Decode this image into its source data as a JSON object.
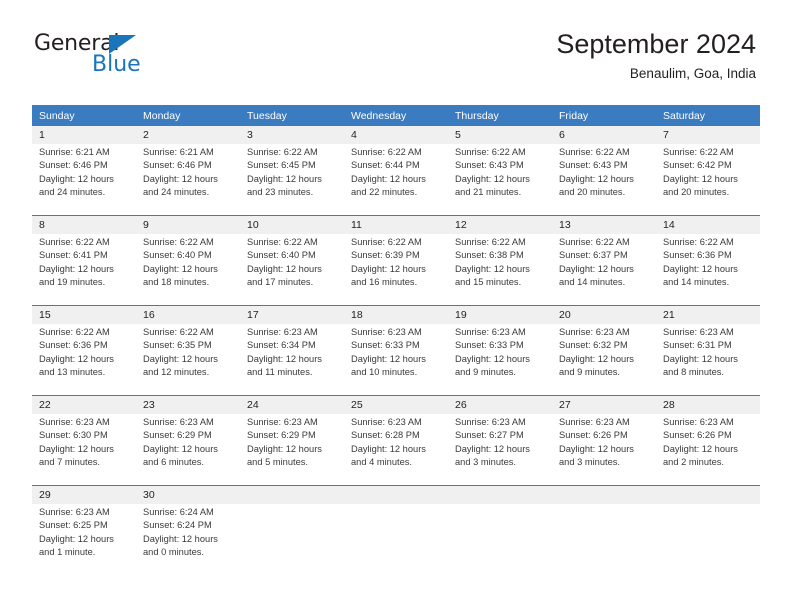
{
  "brand": {
    "name_part1": "General",
    "name_part2": "Blue",
    "accent_color": "#1b75bb"
  },
  "header": {
    "title": "September 2024",
    "subtitle": "Benaulim, Goa, India"
  },
  "theme": {
    "header_row_bg": "#3b7bbf",
    "day_number_bg": "#f0f0f0",
    "text_color": "#231f20"
  },
  "weekdays": [
    "Sunday",
    "Monday",
    "Tuesday",
    "Wednesday",
    "Thursday",
    "Friday",
    "Saturday"
  ],
  "weeks": [
    [
      {
        "day": "1",
        "lines": [
          "Sunrise: 6:21 AM",
          "Sunset: 6:46 PM",
          "Daylight: 12 hours",
          "and 24 minutes."
        ]
      },
      {
        "day": "2",
        "lines": [
          "Sunrise: 6:21 AM",
          "Sunset: 6:46 PM",
          "Daylight: 12 hours",
          "and 24 minutes."
        ]
      },
      {
        "day": "3",
        "lines": [
          "Sunrise: 6:22 AM",
          "Sunset: 6:45 PM",
          "Daylight: 12 hours",
          "and 23 minutes."
        ]
      },
      {
        "day": "4",
        "lines": [
          "Sunrise: 6:22 AM",
          "Sunset: 6:44 PM",
          "Daylight: 12 hours",
          "and 22 minutes."
        ]
      },
      {
        "day": "5",
        "lines": [
          "Sunrise: 6:22 AM",
          "Sunset: 6:43 PM",
          "Daylight: 12 hours",
          "and 21 minutes."
        ]
      },
      {
        "day": "6",
        "lines": [
          "Sunrise: 6:22 AM",
          "Sunset: 6:43 PM",
          "Daylight: 12 hours",
          "and 20 minutes."
        ]
      },
      {
        "day": "7",
        "lines": [
          "Sunrise: 6:22 AM",
          "Sunset: 6:42 PM",
          "Daylight: 12 hours",
          "and 20 minutes."
        ]
      }
    ],
    [
      {
        "day": "8",
        "lines": [
          "Sunrise: 6:22 AM",
          "Sunset: 6:41 PM",
          "Daylight: 12 hours",
          "and 19 minutes."
        ]
      },
      {
        "day": "9",
        "lines": [
          "Sunrise: 6:22 AM",
          "Sunset: 6:40 PM",
          "Daylight: 12 hours",
          "and 18 minutes."
        ]
      },
      {
        "day": "10",
        "lines": [
          "Sunrise: 6:22 AM",
          "Sunset: 6:40 PM",
          "Daylight: 12 hours",
          "and 17 minutes."
        ]
      },
      {
        "day": "11",
        "lines": [
          "Sunrise: 6:22 AM",
          "Sunset: 6:39 PM",
          "Daylight: 12 hours",
          "and 16 minutes."
        ]
      },
      {
        "day": "12",
        "lines": [
          "Sunrise: 6:22 AM",
          "Sunset: 6:38 PM",
          "Daylight: 12 hours",
          "and 15 minutes."
        ]
      },
      {
        "day": "13",
        "lines": [
          "Sunrise: 6:22 AM",
          "Sunset: 6:37 PM",
          "Daylight: 12 hours",
          "and 14 minutes."
        ]
      },
      {
        "day": "14",
        "lines": [
          "Sunrise: 6:22 AM",
          "Sunset: 6:36 PM",
          "Daylight: 12 hours",
          "and 14 minutes."
        ]
      }
    ],
    [
      {
        "day": "15",
        "lines": [
          "Sunrise: 6:22 AM",
          "Sunset: 6:36 PM",
          "Daylight: 12 hours",
          "and 13 minutes."
        ]
      },
      {
        "day": "16",
        "lines": [
          "Sunrise: 6:22 AM",
          "Sunset: 6:35 PM",
          "Daylight: 12 hours",
          "and 12 minutes."
        ]
      },
      {
        "day": "17",
        "lines": [
          "Sunrise: 6:23 AM",
          "Sunset: 6:34 PM",
          "Daylight: 12 hours",
          "and 11 minutes."
        ]
      },
      {
        "day": "18",
        "lines": [
          "Sunrise: 6:23 AM",
          "Sunset: 6:33 PM",
          "Daylight: 12 hours",
          "and 10 minutes."
        ]
      },
      {
        "day": "19",
        "lines": [
          "Sunrise: 6:23 AM",
          "Sunset: 6:33 PM",
          "Daylight: 12 hours",
          "and 9 minutes."
        ]
      },
      {
        "day": "20",
        "lines": [
          "Sunrise: 6:23 AM",
          "Sunset: 6:32 PM",
          "Daylight: 12 hours",
          "and 9 minutes."
        ]
      },
      {
        "day": "21",
        "lines": [
          "Sunrise: 6:23 AM",
          "Sunset: 6:31 PM",
          "Daylight: 12 hours",
          "and 8 minutes."
        ]
      }
    ],
    [
      {
        "day": "22",
        "lines": [
          "Sunrise: 6:23 AM",
          "Sunset: 6:30 PM",
          "Daylight: 12 hours",
          "and 7 minutes."
        ]
      },
      {
        "day": "23",
        "lines": [
          "Sunrise: 6:23 AM",
          "Sunset: 6:29 PM",
          "Daylight: 12 hours",
          "and 6 minutes."
        ]
      },
      {
        "day": "24",
        "lines": [
          "Sunrise: 6:23 AM",
          "Sunset: 6:29 PM",
          "Daylight: 12 hours",
          "and 5 minutes."
        ]
      },
      {
        "day": "25",
        "lines": [
          "Sunrise: 6:23 AM",
          "Sunset: 6:28 PM",
          "Daylight: 12 hours",
          "and 4 minutes."
        ]
      },
      {
        "day": "26",
        "lines": [
          "Sunrise: 6:23 AM",
          "Sunset: 6:27 PM",
          "Daylight: 12 hours",
          "and 3 minutes."
        ]
      },
      {
        "day": "27",
        "lines": [
          "Sunrise: 6:23 AM",
          "Sunset: 6:26 PM",
          "Daylight: 12 hours",
          "and 3 minutes."
        ]
      },
      {
        "day": "28",
        "lines": [
          "Sunrise: 6:23 AM",
          "Sunset: 6:26 PM",
          "Daylight: 12 hours",
          "and 2 minutes."
        ]
      }
    ],
    [
      {
        "day": "29",
        "lines": [
          "Sunrise: 6:23 AM",
          "Sunset: 6:25 PM",
          "Daylight: 12 hours",
          "and 1 minute."
        ]
      },
      {
        "day": "30",
        "lines": [
          "Sunrise: 6:24 AM",
          "Sunset: 6:24 PM",
          "Daylight: 12 hours",
          "and 0 minutes."
        ]
      },
      {
        "day": "",
        "lines": []
      },
      {
        "day": "",
        "lines": []
      },
      {
        "day": "",
        "lines": []
      },
      {
        "day": "",
        "lines": []
      },
      {
        "day": "",
        "lines": []
      }
    ]
  ]
}
